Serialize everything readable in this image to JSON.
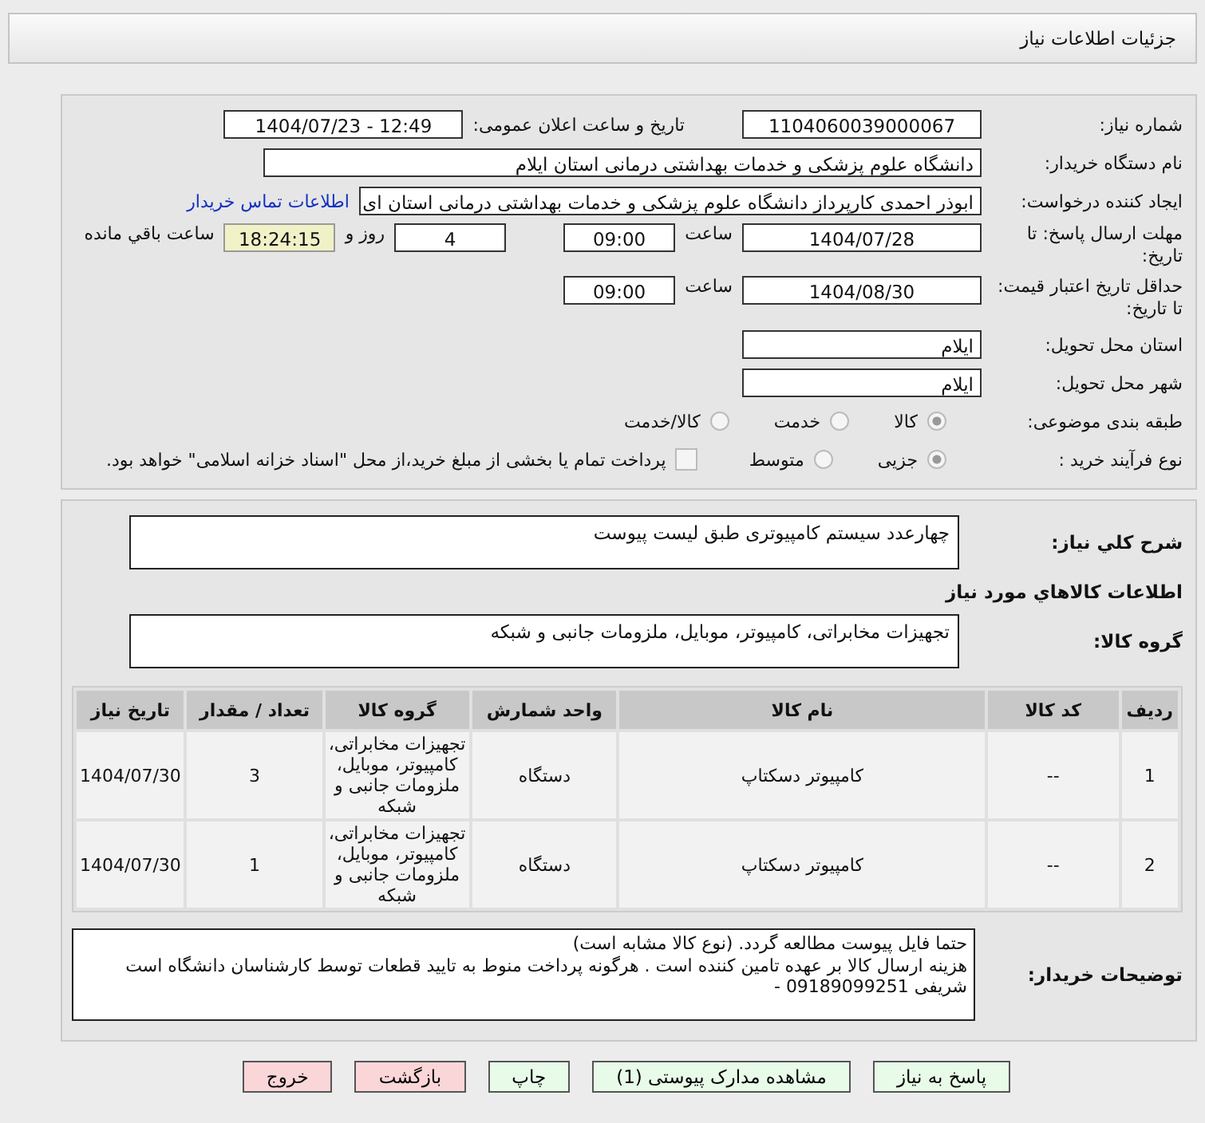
{
  "header": {
    "title": "جزئیات اطلاعات نیاز"
  },
  "form": {
    "need_number": {
      "label": "شماره نیاز:",
      "value": "1104060039000067"
    },
    "announce": {
      "label": "تاریخ و ساعت اعلان عمومی:",
      "value": "1404/07/23 - 12:49"
    },
    "buyer": {
      "label": "نام دستگاه خریدار:",
      "value": "دانشگاه علوم پزشکی و خدمات بهداشتی درمانی استان ایلام"
    },
    "creator": {
      "label": "ایجاد کننده درخواست:",
      "value": "ابوذر احمدی کارپرداز دانشگاه علوم پزشکی و خدمات بهداشتی درمانی استان ای",
      "link": "اطلاعات تماس خریدار"
    },
    "deadline": {
      "label": "مهلت ارسال پاسخ: تا تاریخ:",
      "date": "1404/07/28",
      "time_label": "ساعت",
      "time": "09:00",
      "days": "4",
      "days_label": "روز و",
      "remaining": "18:24:15",
      "remaining_label": "ساعت باقي مانده"
    },
    "validity": {
      "label": "حداقل تاریخ اعتبار قیمت: تا تاریخ:",
      "date": "1404/08/30",
      "time_label": "ساعت",
      "time": "09:00"
    },
    "province": {
      "label": "استان محل تحویل:",
      "value": "ایلام"
    },
    "city": {
      "label": "شهر محل تحویل:",
      "value": "ایلام"
    },
    "category": {
      "label": "طبقه بندی موضوعی:",
      "options": [
        {
          "label": "کالا",
          "selected": true
        },
        {
          "label": "خدمت",
          "selected": false
        },
        {
          "label": "کالا/خدمت",
          "selected": false
        }
      ]
    },
    "process": {
      "label": "نوع فرآیند خرید :",
      "options": [
        {
          "label": "جزیی",
          "selected": true
        },
        {
          "label": "متوسط",
          "selected": false
        }
      ],
      "payment": {
        "checked": false,
        "label": "پرداخت تمام یا بخشی از مبلغ خرید،از محل \"اسناد خزانه اسلامی\" خواهد بود."
      }
    }
  },
  "description": {
    "label": "شرح کلي نیاز:",
    "value": "چهارعدد سیستم کامپیوتری طبق لیست پیوست"
  },
  "goods_heading": "اطلاعات کالاهاي مورد نیاز",
  "goods_group": {
    "label": "گروه کالا:",
    "value": "تجهیزات مخابراتی، کامپیوتر، موبایل، ملزومات جانبی و شبکه"
  },
  "table": {
    "columns": [
      "ردیف",
      "کد کالا",
      "نام کالا",
      "واحد شمارش",
      "گروه کالا",
      "تعداد / مقدار",
      "تاریخ نیاز"
    ],
    "rows": [
      [
        "1",
        "--",
        "کامپیوتر دسکتاپ",
        "دستگاه",
        "تجهیزات مخابراتی، کامپیوتر، موبایل، ملزومات جانبی و شبکه",
        "3",
        "1404/07/30"
      ],
      [
        "2",
        "--",
        "کامپیوتر دسکتاپ",
        "دستگاه",
        "تجهیزات مخابراتی، کامپیوتر، موبایل، ملزومات جانبی و شبکه",
        "1",
        "1404/07/30"
      ]
    ]
  },
  "notes": {
    "label": "توضیحات خریدار:",
    "value": "حتما فایل  پیوست مطالعه گردد.  (نوع کالا مشابه است)\nهزینه ارسال کالا بر عهده تامین کننده است . هرگونه پرداخت منوط به تایید قطعات توسط کارشناسان دانشگاه است\nشریفی 09189099251 -"
  },
  "buttons": [
    {
      "label": "پاسخ به نیاز",
      "kind": "action"
    },
    {
      "label": "مشاهده مدارک پیوستی (1)",
      "kind": "action"
    },
    {
      "label": "چاپ",
      "kind": "action"
    },
    {
      "label": "بازگشت",
      "kind": "cancel"
    },
    {
      "label": "خروج",
      "kind": "cancel"
    }
  ]
}
